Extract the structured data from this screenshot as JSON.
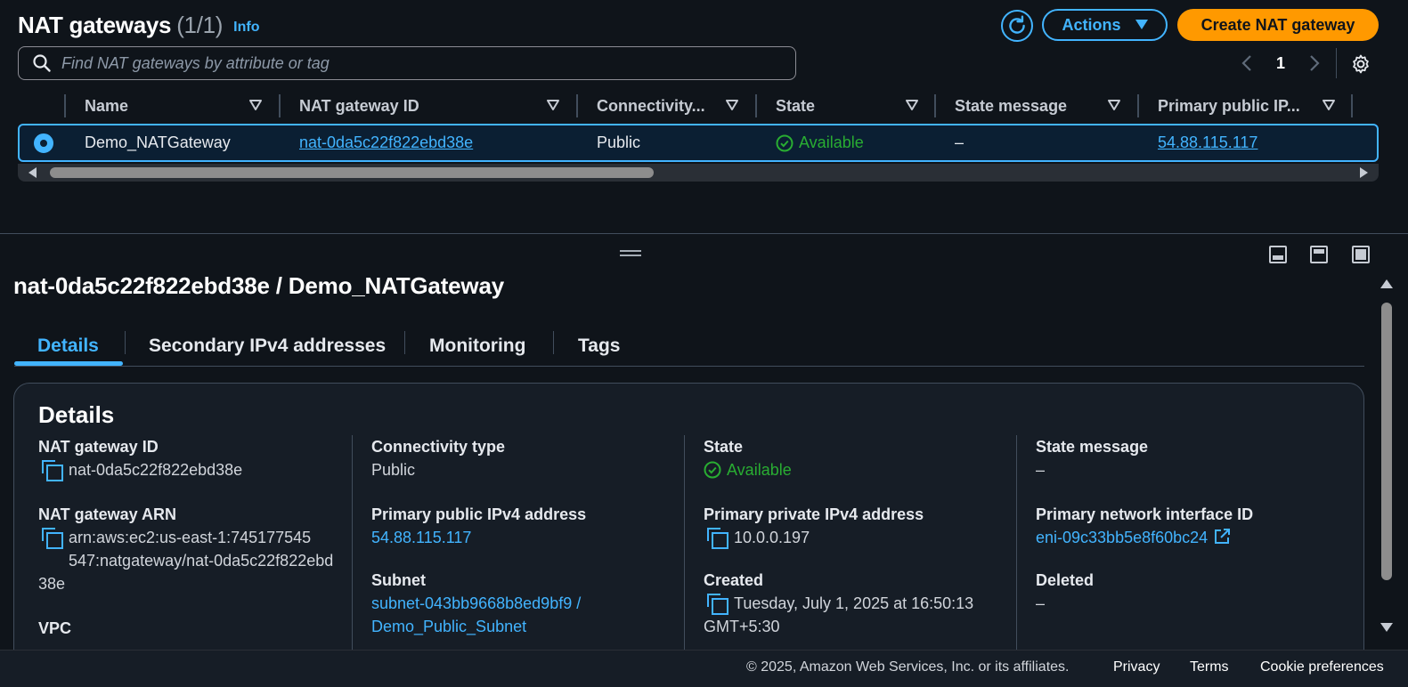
{
  "header": {
    "title": "NAT gateways",
    "count": "(1/1)",
    "info": "Info",
    "actions_label": "Actions",
    "create_label": "Create NAT gateway"
  },
  "search": {
    "placeholder": "Find NAT gateways by attribute or tag"
  },
  "pagination": {
    "page": "1"
  },
  "table": {
    "columns": [
      "Name",
      "NAT gateway ID",
      "Connectivity...",
      "State",
      "State message",
      "Primary public IP..."
    ],
    "rows": [
      {
        "name": "Demo_NATGateway",
        "id": "nat-0da5c22f822ebd38e",
        "connectivity": "Public",
        "state": "Available",
        "state_message": "–",
        "public_ip": "54.88.115.117"
      }
    ]
  },
  "detail": {
    "title": "nat-0da5c22f822ebd38e / Demo_NATGateway",
    "tabs": [
      "Details",
      "Secondary IPv4 addresses",
      "Monitoring",
      "Tags"
    ],
    "card_title": "Details",
    "fields": {
      "nat_id": {
        "label": "NAT gateway ID",
        "value": "nat-0da5c22f822ebd38e"
      },
      "arn": {
        "label": "NAT gateway ARN",
        "line1": "arn:aws:ec2:us-east-1:745177545",
        "line2": "547:natgateway/nat-0da5c22f822ebd",
        "line3": "38e"
      },
      "vpc": {
        "label": "VPC"
      },
      "connectivity": {
        "label": "Connectivity type",
        "value": "Public"
      },
      "public_ip": {
        "label": "Primary public IPv4 address",
        "value": "54.88.115.117"
      },
      "subnet": {
        "label": "Subnet",
        "line1": "subnet-043bb9668b8ed9bf9 /",
        "line2": "Demo_Public_Subnet"
      },
      "state": {
        "label": "State",
        "value": "Available"
      },
      "private_ip": {
        "label": "Primary private IPv4 address",
        "value": "10.0.0.197"
      },
      "created": {
        "label": "Created",
        "line1": "Tuesday, July 1, 2025 at 16:50:13",
        "line2": "GMT+5:30"
      },
      "state_message": {
        "label": "State message",
        "value": "–"
      },
      "eni": {
        "label": "Primary network interface ID",
        "value": "eni-09c33bb5e8f60bc24"
      },
      "deleted": {
        "label": "Deleted",
        "value": "–"
      }
    }
  },
  "footer": {
    "copyright": "© 2025, Amazon Web Services, Inc. or its affiliates.",
    "privacy": "Privacy",
    "terms": "Terms",
    "cookies": "Cookie preferences"
  },
  "colors": {
    "accent": "#42b4ff",
    "primary_button": "#ff9900",
    "success": "#29ad32",
    "background": "#0f141a"
  }
}
